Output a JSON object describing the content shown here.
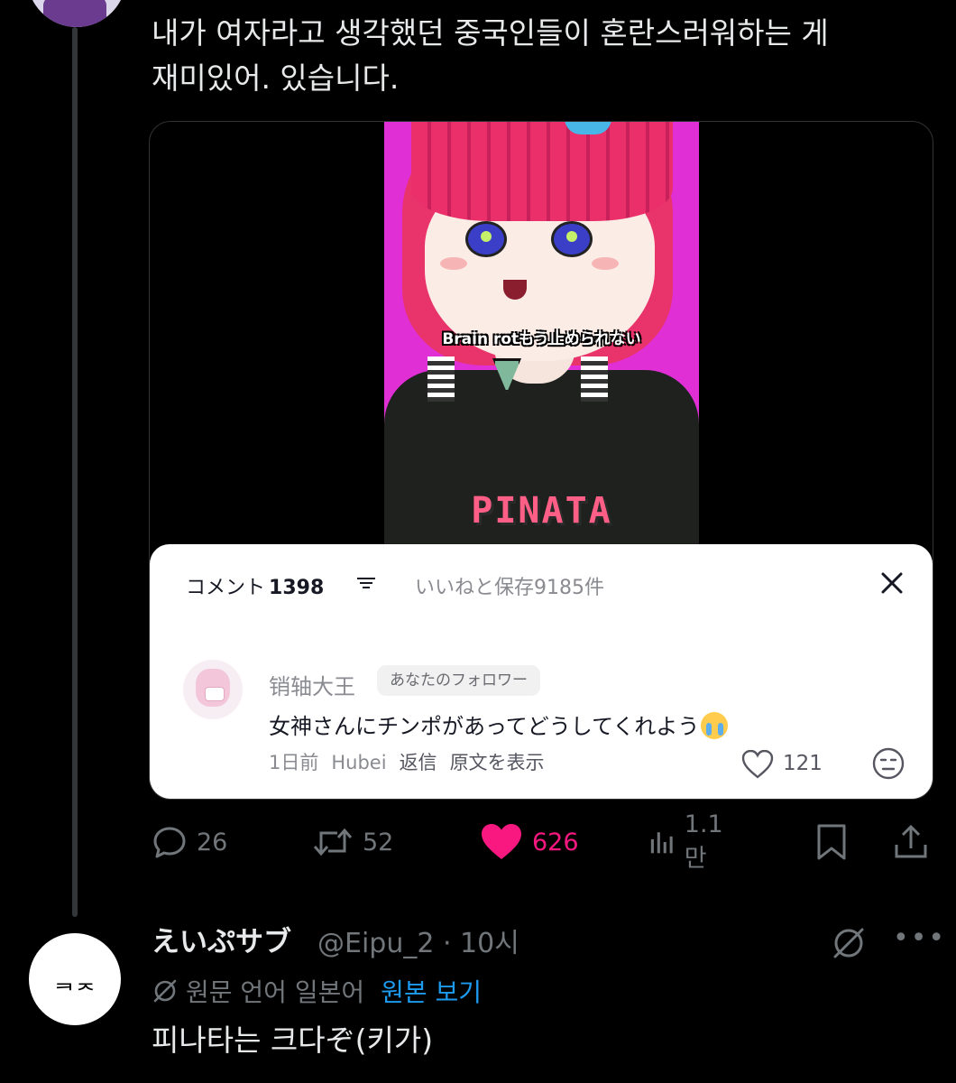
{
  "tweet": {
    "text": "내가 여자라고 생각했던 중국인들이 혼란스러워하는 게\n재미있어. 있습니다."
  },
  "media": {
    "video_caption": "Brain rotもう止められない",
    "shirt_text": "PINATA"
  },
  "comment_sheet": {
    "comments_label": "コメント",
    "comments_count": "1398",
    "likes_saved": "いいねと保存9185件",
    "comment": {
      "username": "销轴大王",
      "badge": "あなたのフォロワー",
      "text": "女神さんにチンポがあってどうしてくれよう",
      "time": "1日前",
      "location": "Hubei",
      "reply": "返信",
      "show_original": "原文を表示",
      "likes": "121"
    }
  },
  "actions": {
    "replies": "26",
    "reposts": "52",
    "likes": "626",
    "views": "1.1만",
    "like_color": "#f91880"
  },
  "reply": {
    "name": "えいぷサブ",
    "handle": "@Eipu_2 · 10시",
    "translate_note": "원문 언어 일본어",
    "show_original": "원본 보기",
    "text": "피나타는 크다ぞ(키가)",
    "avatar_glyph": "ᆿᆽ"
  }
}
